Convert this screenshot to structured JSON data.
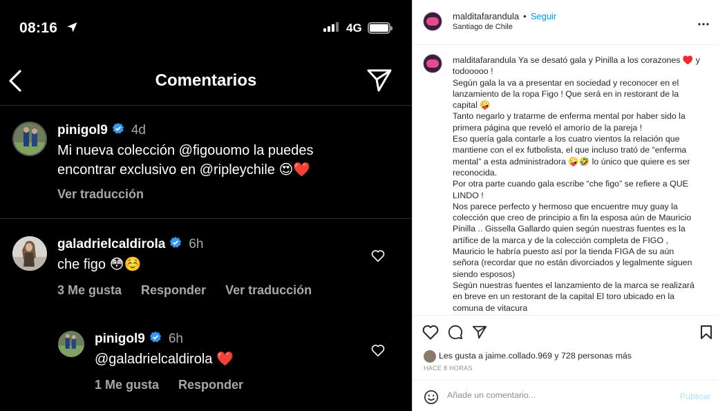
{
  "phone": {
    "status_time": "08:16",
    "network": "4G",
    "header_title": "Comentarios",
    "comments": [
      {
        "username": "pinigol9",
        "ago": "4d",
        "text": "Mi nueva colección @figouomo la puedes encontrar exclusivo en @ripleychile 😍❤️",
        "actions": [
          "Ver traducción"
        ]
      },
      {
        "username": "galadrielcaldirola",
        "ago": "6h",
        "text": "che figo 😳☺️",
        "actions": [
          "3 Me gusta",
          "Responder",
          "Ver traducción"
        ]
      },
      {
        "username": "pinigol9",
        "ago": "6h",
        "text": "@galadrielcaldirola ❤️",
        "actions": [
          "1 Me gusta",
          "Responder"
        ]
      }
    ]
  },
  "ig": {
    "username": "malditafarandula",
    "separator": "•",
    "follow_label": "Seguir",
    "location": "Santiago de Chile",
    "caption_username": "malditafarandula",
    "caption_lines": [
      "Ya se desató gala y Pinilla a los corazones ♥️ y todooooo !",
      "Según gala la va a presentar en sociedad y reconocer en el lanzamiento de la ropa Figo ! Que será en in restorant de la capital 🤪",
      "Tanto negarlo y tratarme de enferma mental por haber sido la primera página que reveló el amorío de la pareja !",
      "Eso quería gala contarle a los cuatro vientos la relación que mantiene con el ex futbolista, el que incluso trató de “enferma mental” a esta administradora 🤪🤣 lo único que quiere es ser reconocida.",
      "Por otra parte cuando gala escribe “che figo” se refiere a QUE LINDO !",
      "Nos parece perfecto y hermoso que encuentre muy guay la colección que creo de principio a fin la esposa aún de Mauricio Pinilla .. Gissella Gallardo quien según nuestras fuentes es la artífice de la marca y de la colección completa de FIGO , Mauricio le habría puesto así por la tienda FIGA de su aún señora (recordar que no están divorciados y legalmente siguen siendo esposos)",
      "Según nuestras fuentes el lanzamiento de la marca se realizará en breve en un restorant de la capital El toro ubicado en la comuna de vitacura"
    ],
    "likes_prefix": "Les gusta a ",
    "likes_user": "jaime.collado.969",
    "likes_suffix": " y 728 personas más",
    "time": "HACE 8 HORAS",
    "comment_placeholder": "Añade un comentario...",
    "publish_label": "Publicar",
    "colors": {
      "accent": "#0095f6",
      "publish_disabled": "#b2dffc",
      "phone_bg": "#000000",
      "verified": "#3897f0"
    }
  }
}
